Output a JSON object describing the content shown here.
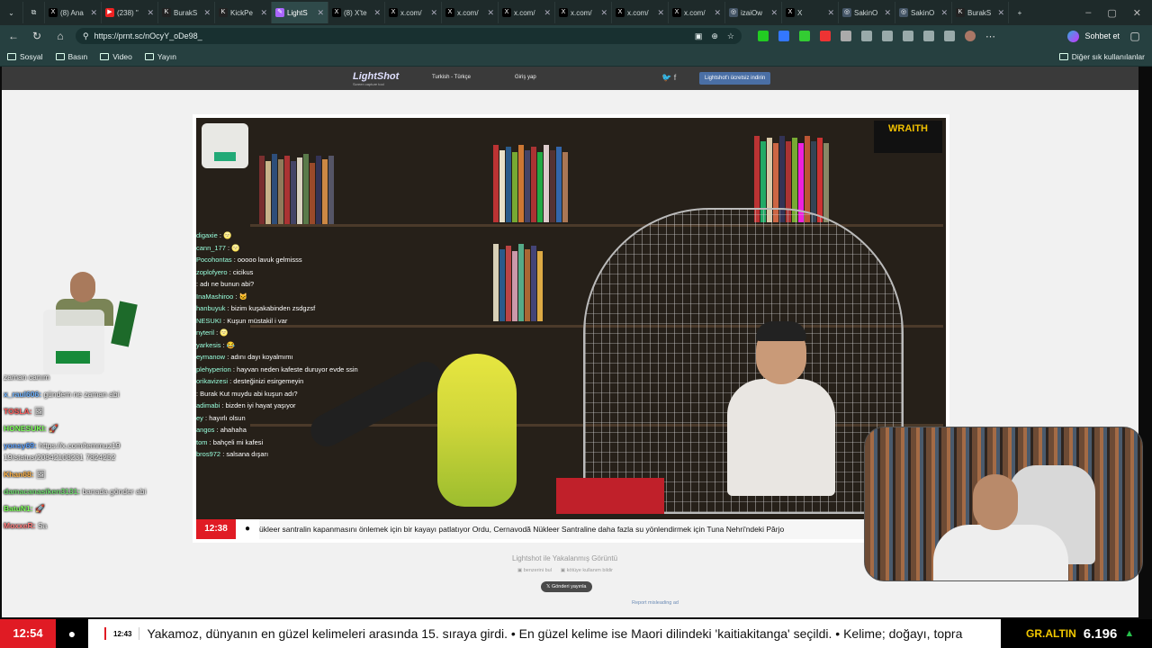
{
  "tabs": [
    {
      "icon": "x-icon",
      "label": "(8) Ana"
    },
    {
      "icon": "youtube-icon",
      "label": "(238) \""
    },
    {
      "icon": "kick-icon",
      "label": "BurakS"
    },
    {
      "icon": "kick-icon",
      "label": "KickPe"
    },
    {
      "icon": "lightshot-icon",
      "label": "LightS"
    },
    {
      "icon": "x-icon",
      "label": "(8) X'te"
    },
    {
      "icon": "x-icon",
      "label": "x.com/"
    },
    {
      "icon": "x-icon",
      "label": "x.com/"
    },
    {
      "icon": "x-icon",
      "label": "x.com/"
    },
    {
      "icon": "x-icon",
      "label": "x.com/"
    },
    {
      "icon": "x-icon",
      "label": "x.com/"
    },
    {
      "icon": "x-icon",
      "label": "x.com/"
    },
    {
      "icon": "globe-icon",
      "label": "izaiOw"
    },
    {
      "icon": "x-icon",
      "label": "X"
    },
    {
      "icon": "globe-icon",
      "label": "SakinO"
    },
    {
      "icon": "globe-icon",
      "label": "SakinO"
    },
    {
      "icon": "kick-icon",
      "label": "BurakS"
    }
  ],
  "toolbar": {
    "url": "https://prnt.sc/nOcyY_oDe98_",
    "chat_label": "Sohbet et"
  },
  "bookmarks": [
    "Sosyal",
    "Basın",
    "Video",
    "Yayın"
  ],
  "bookmarks_other": "Diğer sık kullanılanlar",
  "lightshot": {
    "logo": "LightShot",
    "tagline": "Screen capture tool",
    "lang": "Turkish - Türkçe",
    "login": "Giriş yap",
    "download": "Lightshot'ı ücretsiz indirin",
    "caption": "Lightshot ile Yakalanmış Görüntü",
    "similar": "benzerini bul",
    "report_abuse": "kötüye kullanım bildir",
    "send": "Gönderi yayınla",
    "report": "Report misleading ad"
  },
  "stream": {
    "badge": "WRAITH",
    "news_time": "12:38",
    "news_text": "ükleer santralin kapanmasını önlemek için bir kayayı patlatıyor Ordu, Cernavodă Nükleer Santraline daha fazla su yönlendirmek için Tuna Nehri'ndeki Pârjo",
    "overlay_chat": [
      {
        "u": "digaxie",
        "m": "🌝"
      },
      {
        "u": "cann_177",
        "m": "🌝"
      },
      {
        "u": "Pocohontas",
        "m": "ooooo lavuk gelmisss"
      },
      {
        "u": "zoplofyero",
        "m": "cicikus"
      },
      {
        "u": "",
        "m": "adı ne bunun abi?"
      },
      {
        "u": "InaMashiroo",
        "m": "🐱"
      },
      {
        "u": "hanbuyuk",
        "m": "bizim kuşakabinden zsdgzsf"
      },
      {
        "u": "NESUKI",
        "m": "Kuşun müstakil i var"
      },
      {
        "u": "nyteril",
        "m": "🌝"
      },
      {
        "u": "yarkesis",
        "m": "😂"
      },
      {
        "u": "eymanow",
        "m": "adını dayı koyalmımı"
      },
      {
        "u": "plehyperion",
        "m": "hayvan neden kafeste duruyor evde ssin"
      },
      {
        "u": "orikavizesi",
        "m": "desteğinizi esirgemeyin"
      },
      {
        "u": "",
        "m": "Burak Kut muydu abi kuşun adı?"
      },
      {
        "u": "adimabi",
        "m": "bizden iyi hayat yaşıyor"
      },
      {
        "u": "ey",
        "m": "hayırlı olsun"
      },
      {
        "u": "angos",
        "m": "ahahaha"
      },
      {
        "u": "tom",
        "m": "bahçeli mi kafesi"
      },
      {
        "u": "bros972",
        "m": "salsana dışarı"
      }
    ]
  },
  "left_chat": [
    {
      "u": "",
      "m": "zaman canım",
      "c": "#ffffff"
    },
    {
      "u": "x_raul606:",
      "m": "gündem ne zaman abi",
      "c": "#6fb3ff"
    },
    {
      "u": "TOSLA:",
      "m": "🖼",
      "c": "#ff5b5b"
    },
    {
      "u": "HONESUKI:",
      "m": "🚀",
      "c": "#7dff5a"
    },
    {
      "u": "yonsy69:",
      "m": "https://x.com/temmuz19 19/status/20842108231 7824252",
      "c": "#5aa0ff"
    },
    {
      "u": "Khan68:",
      "m": "🖼",
      "c": "#ffb347"
    },
    {
      "u": "damacanasiken3131:",
      "m": "banada gönder abi",
      "c": "#6fdc6f"
    },
    {
      "u": "BatuN1:",
      "m": "🚀",
      "c": "#7dff5a"
    },
    {
      "u": "MoxxeR:",
      "m": "Sa",
      "c": "#ff7b7b"
    }
  ],
  "ticker": {
    "time": "12:54",
    "small_time": "12:43",
    "text": "Yakamoz, dünyanın en güzel kelimeleri arasında 15. sıraya girdi. • En güzel kelime ise Maori dilindeki 'kaitiakitanga' seçildi. • Kelime; doğayı, topra",
    "gold_label": "GR.ALTIN",
    "gold_value": "6.196",
    "gold_up": "▲"
  },
  "colors": {
    "accent_red": "#e01b24",
    "gold": "#f3c900",
    "up_green": "#27c24c"
  }
}
